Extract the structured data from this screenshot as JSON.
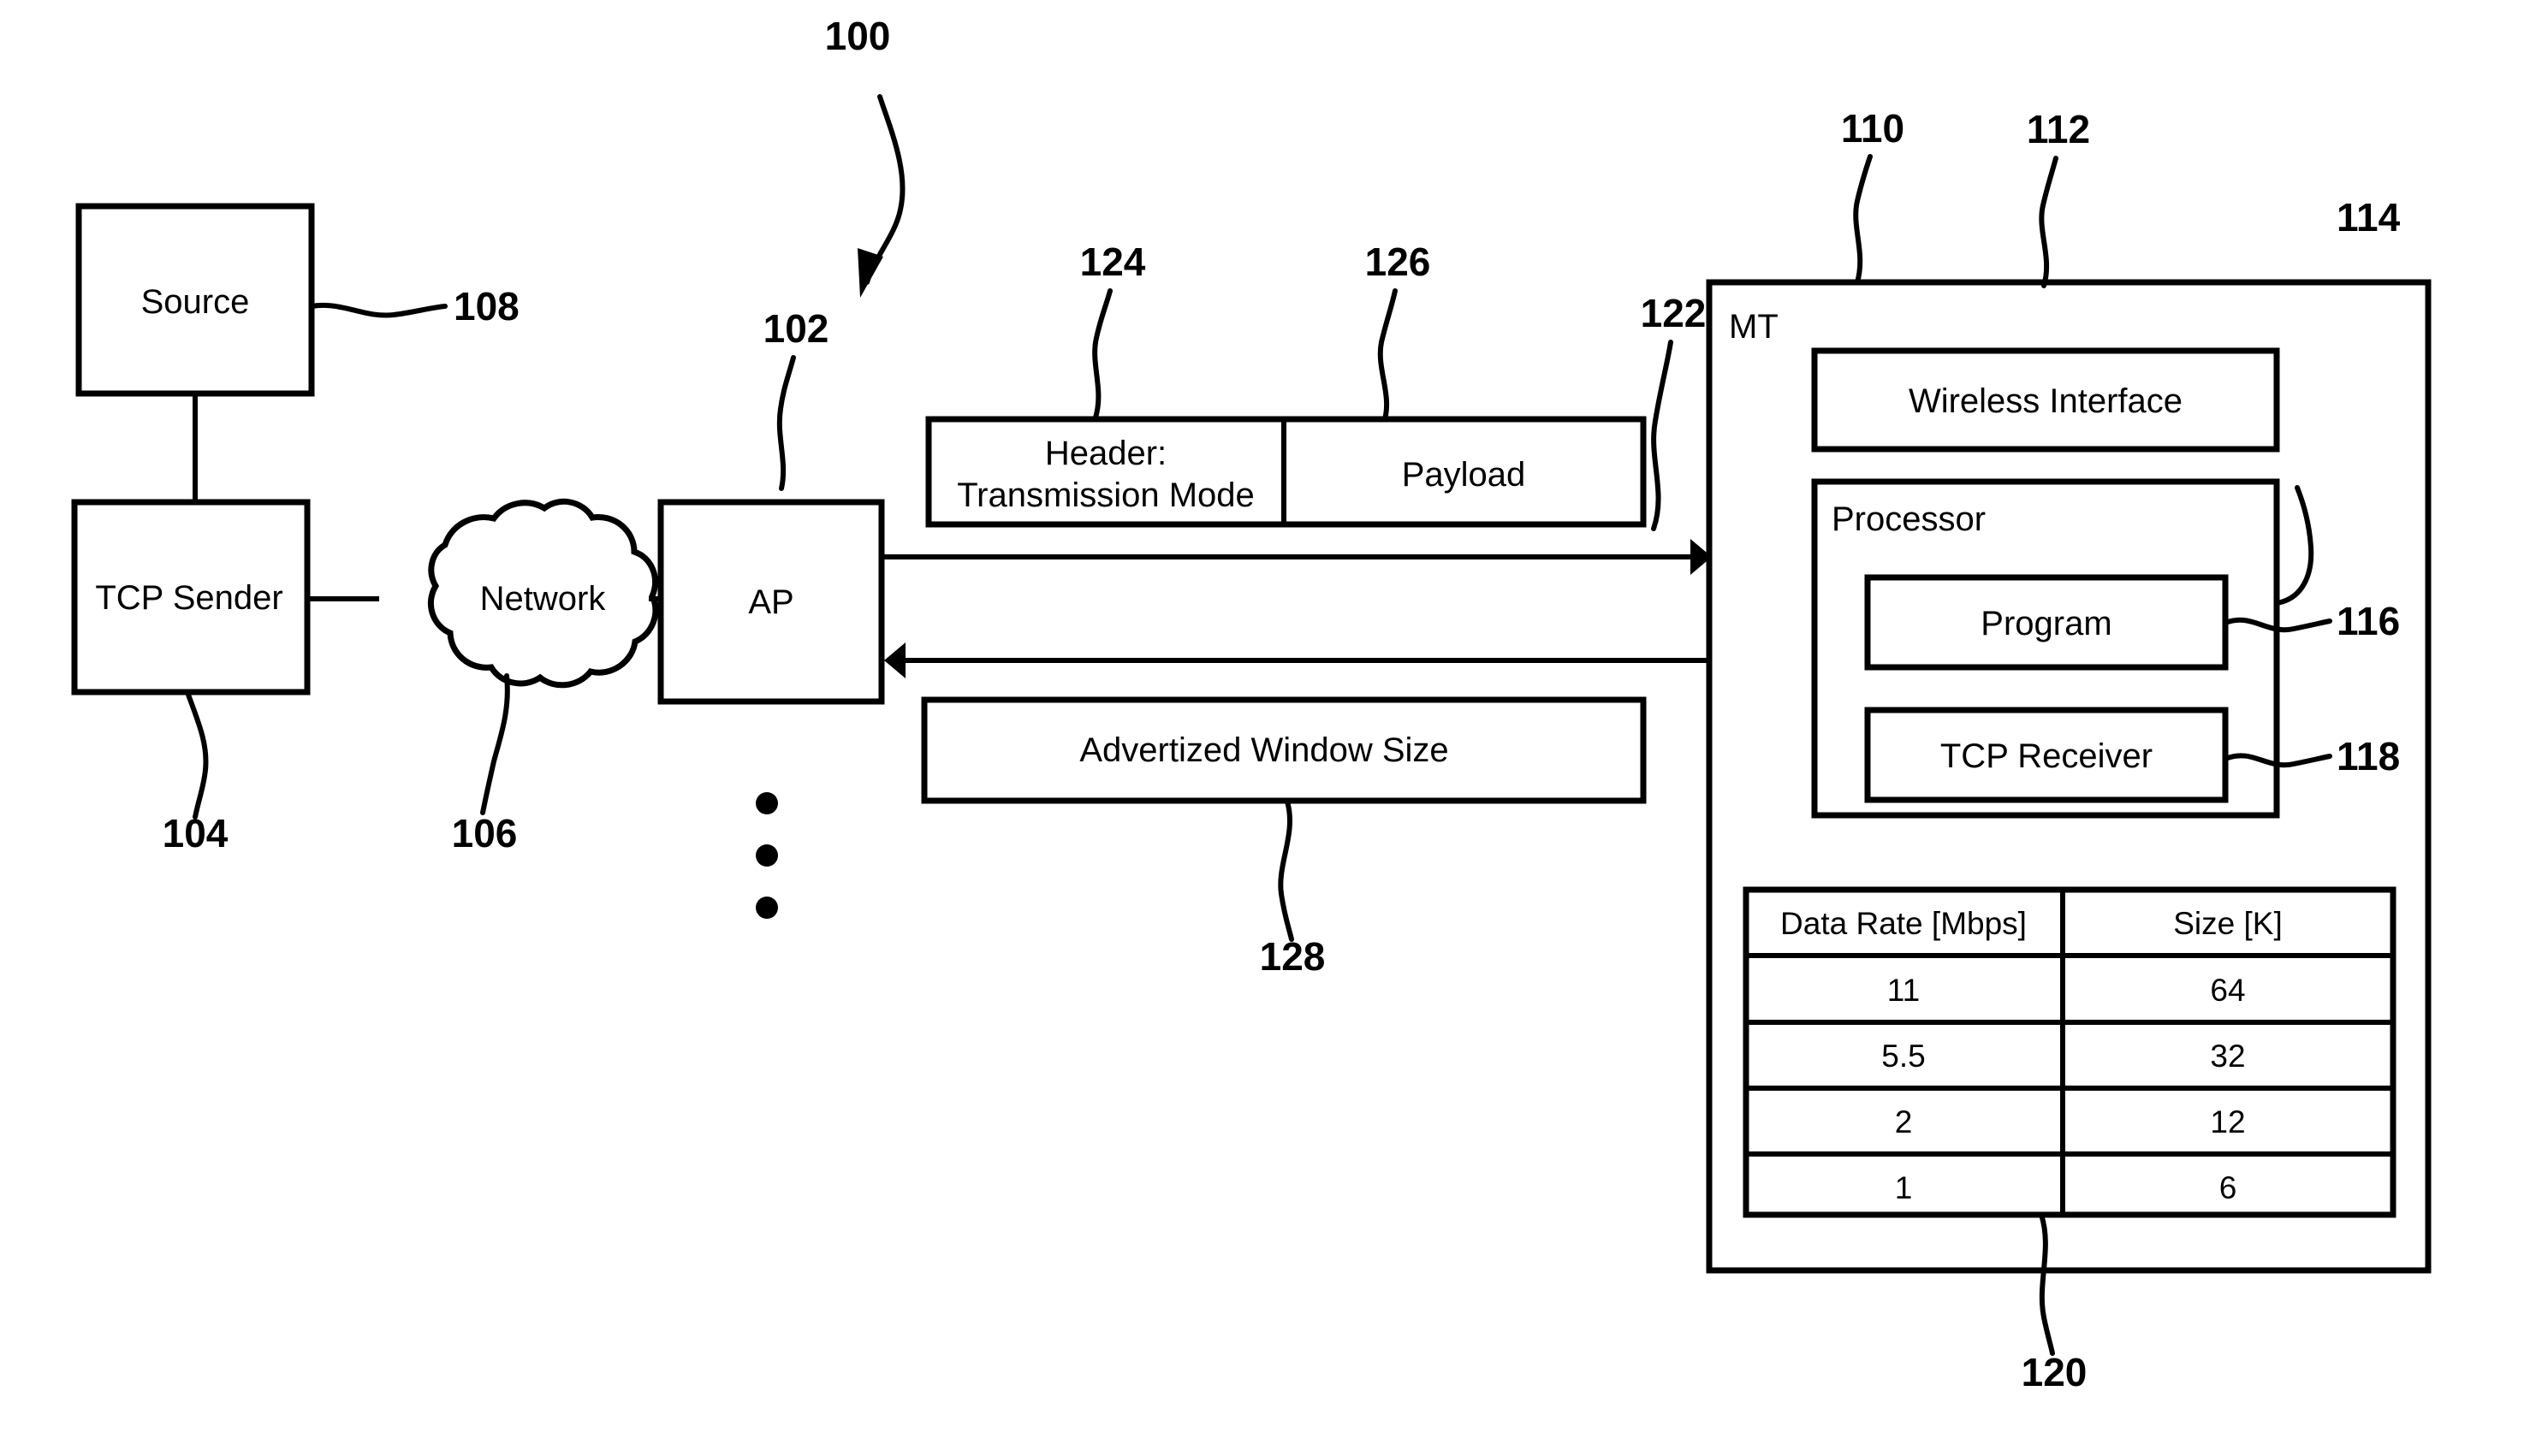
{
  "figure": {
    "figure_ref": "100"
  },
  "nodes": {
    "source": {
      "label": "Source",
      "ref": "108"
    },
    "tcp_sender": {
      "label": "TCP Sender",
      "ref": "104"
    },
    "network": {
      "label": "Network",
      "ref": "106"
    },
    "ap": {
      "label": "AP",
      "ref": "102"
    },
    "mt": {
      "label": "MT",
      "ref": "110"
    },
    "wireless_interface": {
      "label": "Wireless Interface",
      "ref": "112"
    },
    "processor": {
      "label": "Processor",
      "ref": "114"
    },
    "program": {
      "label": "Program",
      "ref": "116"
    },
    "tcp_receiver": {
      "label": "TCP Receiver",
      "ref": "118"
    }
  },
  "packet": {
    "ref": "122",
    "header": {
      "line1": "Header:",
      "line2": "Transmission Mode",
      "ref": "124"
    },
    "payload": {
      "label": "Payload",
      "ref": "126"
    }
  },
  "feedback": {
    "label": "Advertized Window Size",
    "ref": "128"
  },
  "table": {
    "ref": "120",
    "columns": [
      "Data Rate [Mbps]",
      "Size [K]"
    ],
    "rows": [
      [
        "11",
        "64"
      ],
      [
        "5.5",
        "32"
      ],
      [
        "2",
        "12"
      ],
      [
        "1",
        "6"
      ]
    ]
  },
  "ellipsis": {
    "name": "vertical-ellipsis",
    "count": 3
  },
  "colors": {
    "ink": "#000000",
    "paper": "#ffffff"
  }
}
